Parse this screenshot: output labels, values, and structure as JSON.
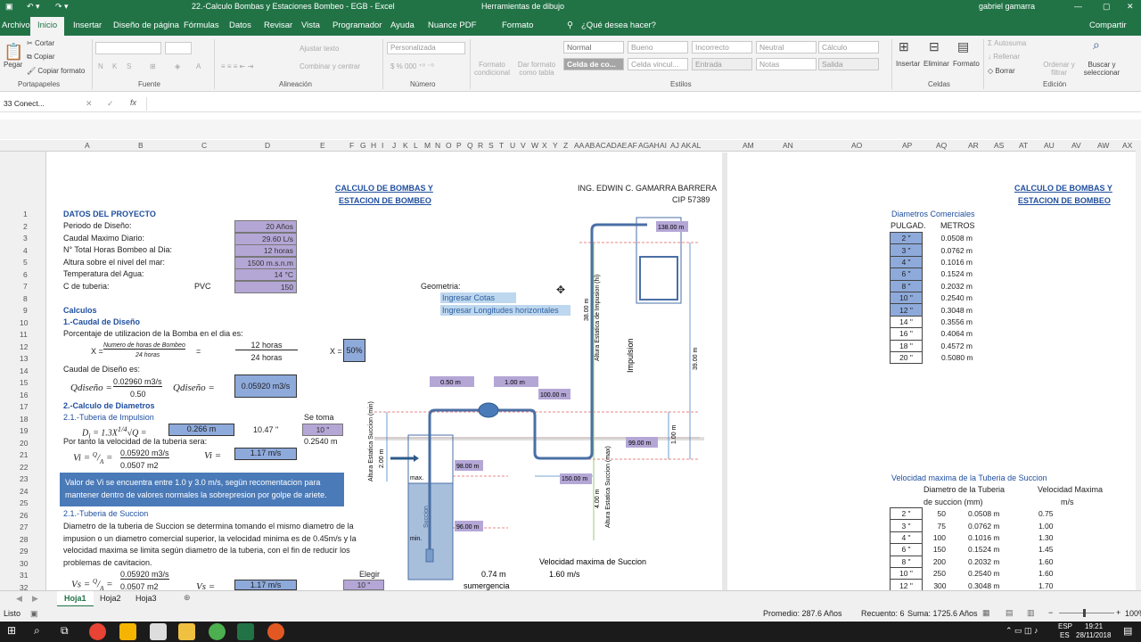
{
  "title": {
    "file": "22.-Calculo Bombas y Estaciones Bombeo - EGB  -  Excel",
    "tools": "Herramientas de dibujo",
    "user": "gabriel gamarra"
  },
  "tabs": [
    "Archivo",
    "Inicio",
    "Insertar",
    "Diseño de página",
    "Fórmulas",
    "Datos",
    "Revisar",
    "Vista",
    "Programador",
    "Ayuda",
    "Nuance PDF",
    "Formato",
    "¿Qué desea hacer?",
    "Compartir"
  ],
  "ribbon": {
    "clipboard": {
      "paste": "Pegar",
      "cut": "Cortar",
      "copy": "Copiar",
      "format": "Copiar formato",
      "group": "Portapapeles"
    },
    "font": {
      "group": "Fuente"
    },
    "alignment": {
      "wrap": "Ajustar texto",
      "merge": "Combinar y centrar",
      "group": "Alineación"
    },
    "number": {
      "format": "Personalizada",
      "group": "Número"
    },
    "styles": {
      "cond": "Formato condicional",
      "table": "Dar formato como tabla",
      "group": "Estilos",
      "boxes": [
        "Normal",
        "Bueno",
        "Incorrecto",
        "Neutral",
        "Cálculo",
        "Celda de co...",
        "Celda vincul...",
        "Entrada",
        "Notas",
        "Salida"
      ]
    },
    "cells": {
      "insert": "Insertar",
      "delete": "Eliminar",
      "format": "Formato",
      "group": "Celdas"
    },
    "editing": {
      "autosum": "Autosuma",
      "fill": "Rellenar",
      "clear": "Borrar",
      "sort": "Ordenar y filtrar",
      "find": "Buscar y seleccionar",
      "group": "Edición"
    }
  },
  "formula_bar": {
    "name_box": "33 Conect...",
    "fx": "fx"
  },
  "columns_left": [
    "A",
    "B",
    "C",
    "D",
    "E",
    "F",
    "G",
    "H",
    "I",
    "J",
    "K",
    "L",
    "M",
    "N",
    "O",
    "P",
    "Q",
    "R",
    "S",
    "T",
    "U",
    "V",
    "W",
    "X",
    "Y",
    "Z",
    "AA",
    "AB",
    "AC",
    "AD",
    "AE",
    "AF",
    "AG",
    "AH",
    "AI",
    "AJ",
    "AK",
    "AL"
  ],
  "columns_right": [
    "AM",
    "AN",
    "AO",
    "AP",
    "AQ",
    "AR",
    "AS",
    "AT",
    "AU",
    "AV",
    "AW",
    "AX"
  ],
  "rows": [
    "1",
    "2",
    "3",
    "4",
    "5",
    "6",
    "7",
    "8",
    "9",
    "10",
    "11",
    "12",
    "13",
    "14",
    "15",
    "16",
    "17",
    "18",
    "19",
    "20",
    "21",
    "22",
    "23",
    "24",
    "25",
    "26",
    "27",
    "28",
    "29",
    "30",
    "31",
    "32"
  ],
  "sheet": {
    "title1": "CALCULO DE BOMBAS Y",
    "title2": "ESTACION DE BOMBEO",
    "engineer": "ING. EDWIN C. GAMARRA BARRERA",
    "cip": "CIP 57389",
    "project_header": "DATOS DEL PROYECTO",
    "project": [
      {
        "label": "Periodo de Diseño:",
        "value": "20 Años"
      },
      {
        "label": "Caudal Maximo Diario:",
        "value": "29.60 L/s"
      },
      {
        "label": "N° Total Horas Bombeo al Dia:",
        "value": "12 horas"
      },
      {
        "label": "Altura sobre el nivel del mar:",
        "value": "1500 m.s.n.m"
      },
      {
        "label": "Temperatura del Agua:",
        "value": "14 °C"
      },
      {
        "label": "C de tuberia:",
        "extra": "PVC",
        "value": "150"
      }
    ],
    "calculos": "Calculos",
    "s1": "1.-Caudal de Diseño",
    "pct_text": "Porcentaje de utilizacion de la Bomba en el dia es:",
    "x_frac_num": "Numero de horas de Bombeo",
    "x_frac_den": "24 horas",
    "h_num": "12 horas",
    "h_den": "24 horas",
    "x_label": "X =",
    "x_value": "50%",
    "qd_text": "Caudal de Diseño es:",
    "qd_lhs": "Qdiseño =",
    "qd_num": "0.02960 m3/s",
    "qd_den": "0.50",
    "qd_eq": "Qdiseño =",
    "qd_value": "0.05920 m3/s",
    "s2": "2.-Calculo de Diametros",
    "s21": "2.1.-Tuberia de Impulsion",
    "se_toma": "Se toma",
    "di_formula": "D",
    "di_value": "0.266 m",
    "di_inch": "10.47 \"",
    "di_take": "10 \"",
    "di_m": "0.2540 m",
    "vel_text": "Por tanto la velocidad de la tuberia sera:",
    "vi_num": "0.05920 m3/s",
    "vi_den": "0.0507 m2",
    "vi_eq": "Vi =",
    "vi_value": "1.17 m/s",
    "note": "Valor de Vi se encuentra entre 1.0 y 3.0 m/s, segün recomentacion para mantener dentro de valores normales la sobrepresion por golpe de ariete.",
    "s22": "2.1.-Tuberia de Succion",
    "succ_text": "Diametro de la tuberia de Succion se determina tomando el mismo diametro de la impusion o un diametro comercial superior, la velocidad minima es de 0.45m/s y la velocidad maxima se limita según diametro de la tuberia, con el fin de reducir los problemas de cavitacion.",
    "vs_num": "0.05920 m3/s",
    "vs_den": "0.0507 m2",
    "vs_eq": "Vs =",
    "vs_value": "1.17 m/s",
    "elegir": "Elegir",
    "elegir_val": "10 \"",
    "geometria": "Geometria:",
    "ing_cotas": "Ingresar Cotas",
    "ing_long": "Ingresar Longitudes horizontales",
    "diag": {
      "d050": "0.50 m",
      "d100": "1.00 m",
      "c100": "100.00 m",
      "c138": "138.00 m",
      "c99": "99.00 m",
      "c98": "98.00 m",
      "c96": "96.00 m",
      "h150": "150.00 m",
      "v38": "38.00 m",
      "v39": "39.00 m",
      "v1": "1.00 m",
      "v2": "2.00 m",
      "v4": "4.00 m",
      "aei": "Altura Estatica de Impusion (hi)",
      "imp": "Impulsion",
      "aes": "Altura Estatica Succion (min)",
      "aesm": "Altura Estatica Succion (max)",
      "max": "max.",
      "min": "min.",
      "succ": "Succion",
      "sum_val": "0.74 m",
      "sum": "sumergencia",
      "vmax": "Velocidad maxima de Succion",
      "vmax_val": "1.60 m/s"
    },
    "right_title1": "CALCULO DE BOMBAS Y",
    "right_title2": "ESTACION DE BOMBEO",
    "diam_title": "Diametros Comerciales",
    "diam_h1": "PULGAD.",
    "diam_h2": "METROS",
    "diam": [
      [
        "2 \"",
        "0.0508 m"
      ],
      [
        "3 \"",
        "0.0762 m"
      ],
      [
        "4 \"",
        "0.1016 m"
      ],
      [
        "6 \"",
        "0.1524 m"
      ],
      [
        "8 \"",
        "0.2032 m"
      ],
      [
        "10 \"",
        "0.2540 m"
      ],
      [
        "12 \"",
        "0.3048 m"
      ],
      [
        "14 \"",
        "0.3556 m"
      ],
      [
        "16 \"",
        "0.4064 m"
      ],
      [
        "18 \"",
        "0.4572 m"
      ],
      [
        "20 \"",
        "0.5080 m"
      ]
    ],
    "vel_title": "Velocidad maxima de la Tuberia de Succion",
    "vel_h1": "Diametro de la Tuberia",
    "vel_h1b": "de succion (mm)",
    "vel_h2": "Velocidad Maxima",
    "vel_h2b": "m/s",
    "vel": [
      [
        "2 \"",
        "50",
        "0.0508 m",
        "0.75"
      ],
      [
        "3 \"",
        "75",
        "0.0762 m",
        "1.00"
      ],
      [
        "4 \"",
        "100",
        "0.1016 m",
        "1.30"
      ],
      [
        "6 \"",
        "150",
        "0.1524 m",
        "1.45"
      ],
      [
        "8 \"",
        "200",
        "0.2032 m",
        "1.60"
      ],
      [
        "10 \"",
        "250",
        "0.2540 m",
        "1.60"
      ],
      [
        "12 \"",
        "300",
        "0.3048 m",
        "1.70"
      ]
    ]
  },
  "sheet_tabs": [
    "Hoja1",
    "Hoja2",
    "Hoja3"
  ],
  "status": {
    "ready": "Listo",
    "avg": "Promedio: 287.6 Años",
    "count": "Recuento: 6",
    "sum": "Suma: 1725.6 Años",
    "zoom": "100%"
  },
  "taskbar": {
    "lang": "ESP",
    "lang2": "ES",
    "time": "19:21",
    "date": "28/11/2018"
  }
}
